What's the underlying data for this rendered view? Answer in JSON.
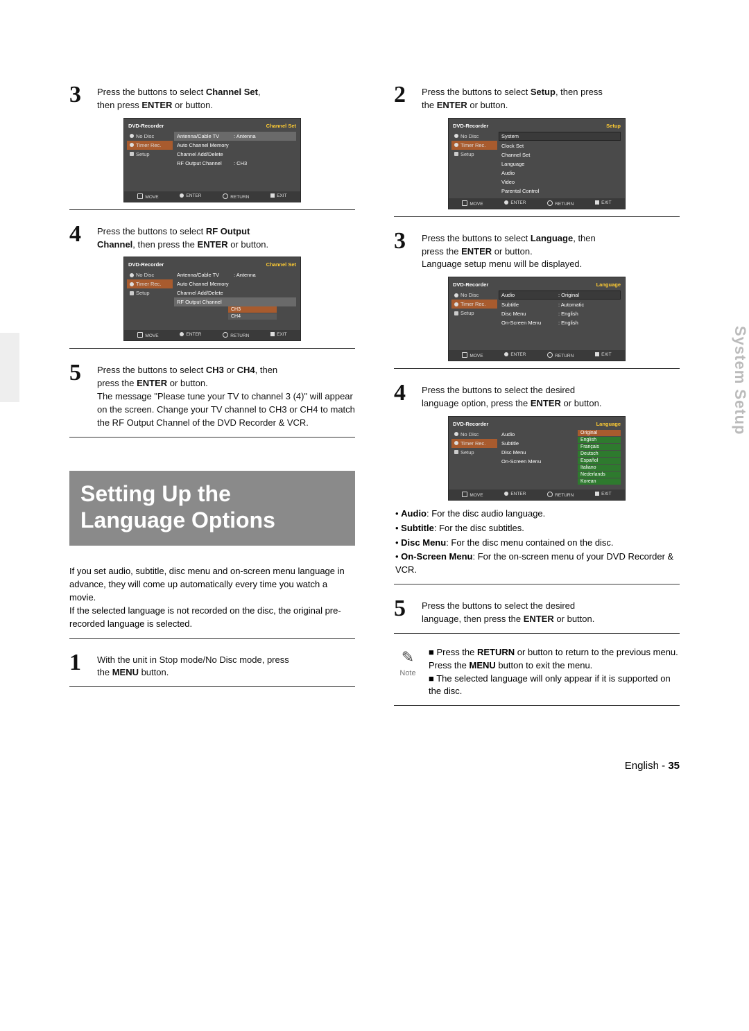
{
  "sideTab": "System Setup",
  "footer": {
    "lang": "English",
    "dash": "-",
    "page": "35"
  },
  "left": {
    "s3": {
      "num": "3",
      "l1a": "Press the ",
      "l1b": " buttons to select ",
      "bold1": "Channel Set",
      "l1c": ",",
      "l2a": "then press ",
      "bold2": "ENTER",
      "l2b": " or ",
      "l2c": " button."
    },
    "s4": {
      "num": "4",
      "l1a": "Press the ",
      "l1b": " buttons to select ",
      "bold1": "RF Output",
      "bold2": "Channel",
      "l2a": ", then press the ",
      "bold3": "ENTER",
      "l2b": " or ",
      "l2c": " button."
    },
    "s5": {
      "num": "5",
      "l1a": "Press the ",
      "l1b": " buttons to select ",
      "bold1": "CH3",
      "mid": " or ",
      "bold2": "CH4",
      "l1c": ", then",
      "l2a": "press the ",
      "bold3": "ENTER",
      "l2b": " or ",
      "l2c": " button.",
      "para": "The message \"Please tune your TV to channel 3 (4)\" will appear on the screen. Change your TV channel to CH3 or CH4 to match the RF Output Channel of the DVD Recorder & VCR."
    },
    "bannerL1": "Setting Up the",
    "bannerL2": "Language Options",
    "intro": "If you set audio, subtitle, disc menu and on-screen menu language in advance, they will come up automatically every time you watch a movie.\nIf the selected language is not recorded on the disc, the original pre-recorded language is selected.",
    "s1": {
      "num": "1",
      "l1": "With the unit in Stop mode/No Disc mode, press",
      "l2a": "the ",
      "bold": "MENU",
      "l2b": " button."
    }
  },
  "right": {
    "s2": {
      "num": "2",
      "l1a": "Press the ",
      "l1b": " buttons to select ",
      "bold1": "Setup",
      "l1c": ", then press",
      "l2a": "the ",
      "bold2": "ENTER",
      "l2b": " or ",
      "l2c": " button."
    },
    "s3": {
      "num": "3",
      "l1a": "Press the ",
      "l1b": " buttons to select ",
      "bold1": "Language",
      "l1c": ", then",
      "l2a": "press the ",
      "bold2": "ENTER",
      "l2b": " or ",
      "l2c": " button.",
      "extra": "Language setup menu will be displayed."
    },
    "s4": {
      "num": "4",
      "l1a": "Press the ",
      "l1b": " buttons to select the desired",
      "l2a": "language option, press the ",
      "bold": "ENTER",
      "l2b": " or ",
      "l2c": " button."
    },
    "bullets": {
      "b1a": "Audio",
      "b1b": ": For the disc audio language.",
      "b2a": "Subtitle",
      "b2b": ": For the disc subtitles.",
      "b3a": "Disc Menu",
      "b3b": ": For the disc menu contained on the disc.",
      "b4a": "On-Screen Menu",
      "b4b": ": For the on-screen menu of your DVD Recorder & VCR."
    },
    "s5": {
      "num": "5",
      "l1a": "Press the ",
      "l1b": " buttons to select the desired",
      "l2a": "language, then press the ",
      "bold": "ENTER",
      "l2b": " or ",
      "l2c": " button."
    },
    "note": {
      "label": "Note",
      "n1a": "Press the ",
      "n1b": "RETURN",
      "n1c": " or ",
      "n1d": " button to return to the previous menu. Press the ",
      "n1e": "MENU",
      "n1f": " button to exit the menu.",
      "n2": "The selected language will only appear if it is supported on the disc."
    }
  },
  "osd": {
    "title": "DVD-Recorder",
    "nodisc": "No Disc",
    "timer": "Timer Rec.",
    "setup": "Setup",
    "foot": {
      "move": "MOVE",
      "enter": "ENTER",
      "return": "RETURN",
      "exit": "EXIT"
    },
    "chset": {
      "title": "Channel Set",
      "r1k": "Antenna/Cable TV",
      "r1v": ": Antenna",
      "r2": "Auto Channel Memory",
      "r3": "Channel Add/Delete",
      "r4k": "RF Output Channel",
      "r4v": ": CH3",
      "ch3": "CH3",
      "ch4": "CH4"
    },
    "setupMenu": {
      "title": "Setup",
      "items": [
        "System",
        "Clock Set",
        "Channel Set",
        "Language",
        "Audio",
        "Video",
        "Parental Control"
      ]
    },
    "lang": {
      "title": "Language",
      "rows": [
        {
          "k": "Audio",
          "v": ": Original"
        },
        {
          "k": "Subtitle",
          "v": ": Automatic"
        },
        {
          "k": "Disc Menu",
          "v": ": English"
        },
        {
          "k": "On-Screen Menu",
          "v": ": English"
        }
      ],
      "opts": [
        "Original",
        "English",
        "Français",
        "Deutsch",
        "Español",
        "Italiano",
        "Nederlands",
        "Korean"
      ]
    }
  }
}
